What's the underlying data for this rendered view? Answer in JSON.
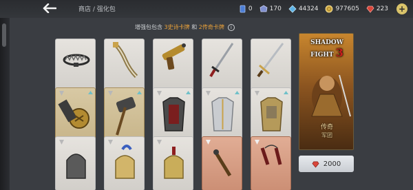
{
  "header": {
    "breadcrumb": "商店 / 强化包",
    "back_icon": "arrow-left-icon"
  },
  "currencies": [
    {
      "name": "card-count",
      "icon": "card-icon",
      "value": "0",
      "color": "#4d7fd6"
    },
    {
      "name": "shards",
      "icon": "shard-icon",
      "value": "170",
      "color": "#7f8fcf"
    },
    {
      "name": "energy",
      "icon": "gem-blue-icon",
      "value": "44324",
      "color": "#5db3e6"
    },
    {
      "name": "coins",
      "icon": "coin-icon",
      "value": "977605",
      "color": "#d8b24a"
    },
    {
      "name": "gems",
      "icon": "ruby-icon",
      "value": "223",
      "color": "#d9463a"
    }
  ],
  "info": {
    "prefix": "增强包包含",
    "epic": "3史诗卡牌",
    "middle": "和",
    "legendary": "2传奇卡牌"
  },
  "cards": [
    {
      "item": "bear-trap"
    },
    {
      "item": "scimitar"
    },
    {
      "item": "hand-cannon"
    },
    {
      "item": "katana"
    },
    {
      "item": "saber"
    },
    {
      "item": "shield"
    },
    {
      "item": "war-hammer"
    },
    {
      "item": "heavy-armor"
    },
    {
      "item": "plate-armor"
    },
    {
      "item": "armor"
    },
    {
      "item": "helmet"
    },
    {
      "item": "helmet-plumed"
    },
    {
      "item": "helmet-crested"
    },
    {
      "item": "ranged-weapon"
    },
    {
      "item": "nunchaku"
    }
  ],
  "pack": {
    "logo_line1": "SHADOW",
    "logo_line2": "FIGHT",
    "logo_number": "3",
    "rarity": "传奇",
    "faction": "军团",
    "price": "2000"
  }
}
